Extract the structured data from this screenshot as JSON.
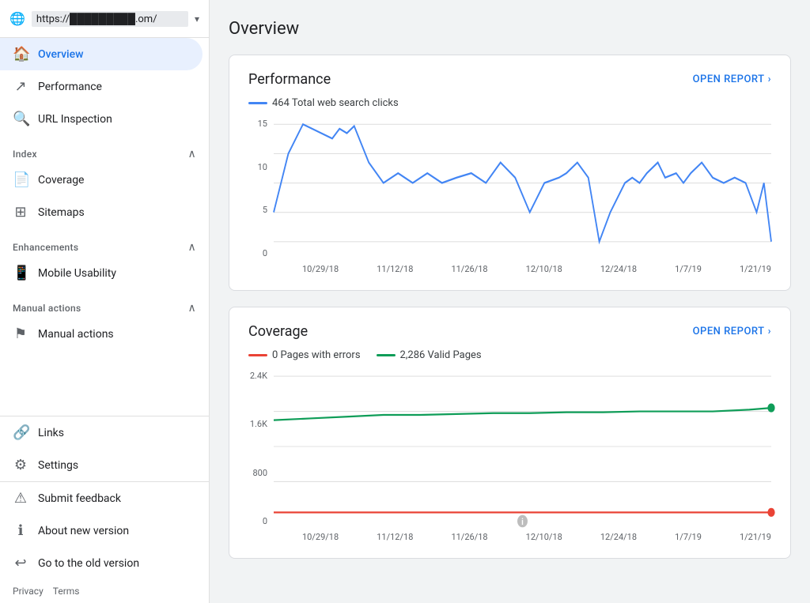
{
  "sidebar": {
    "url": "https://█████████.om/",
    "nav": [
      {
        "id": "overview",
        "label": "Overview",
        "icon": "🏠",
        "active": true
      },
      {
        "id": "performance",
        "label": "Performance",
        "icon": "📈",
        "active": false
      },
      {
        "id": "url-inspection",
        "label": "URL Inspection",
        "icon": "🔍",
        "active": false
      }
    ],
    "sections": [
      {
        "id": "index",
        "label": "Index",
        "collapsed": false,
        "items": [
          {
            "id": "coverage",
            "label": "Coverage",
            "icon": "📄"
          },
          {
            "id": "sitemaps",
            "label": "Sitemaps",
            "icon": "🗺"
          }
        ]
      },
      {
        "id": "enhancements",
        "label": "Enhancements",
        "collapsed": false,
        "items": [
          {
            "id": "mobile-usability",
            "label": "Mobile Usability",
            "icon": "📱"
          }
        ]
      },
      {
        "id": "manual-actions",
        "label": "Manual actions",
        "collapsed": false,
        "items": [
          {
            "id": "manual-actions-item",
            "label": "Manual actions",
            "icon": "🚩"
          }
        ]
      }
    ],
    "bottom_nav": [
      {
        "id": "links",
        "label": "Links",
        "icon": "🔗"
      },
      {
        "id": "settings",
        "label": "Settings",
        "icon": "⚙"
      },
      {
        "id": "submit-feedback",
        "label": "Submit feedback",
        "icon": "⚠"
      },
      {
        "id": "about-new-version",
        "label": "About new version",
        "icon": "ℹ"
      },
      {
        "id": "go-to-old",
        "label": "Go to the old version",
        "icon": "↩"
      }
    ],
    "footer": {
      "privacy": "Privacy",
      "terms": "Terms"
    }
  },
  "main": {
    "title": "Overview",
    "performance_card": {
      "title": "Performance",
      "open_report": "OPEN REPORT",
      "legend": {
        "label": "464 Total web search clicks",
        "color": "#4285f4"
      },
      "y_axis": [
        "15",
        "10",
        "5",
        "0"
      ],
      "x_axis": [
        "10/29/18",
        "11/12/18",
        "11/26/18",
        "12/10/18",
        "12/24/18",
        "1/7/19",
        "1/21/19"
      ]
    },
    "coverage_card": {
      "title": "Coverage",
      "open_report": "OPEN REPORT",
      "legend": [
        {
          "label": "0 Pages with errors",
          "color": "#ea4335",
          "type": "line"
        },
        {
          "label": "2,286 Valid Pages",
          "color": "#0f9d58",
          "type": "line"
        }
      ],
      "y_axis": [
        "2.4K",
        "1.6K",
        "800",
        "0"
      ],
      "x_axis": [
        "10/29/18",
        "11/12/18",
        "11/26/18",
        "12/10/18",
        "12/24/18",
        "1/7/19",
        "1/21/19"
      ]
    }
  },
  "icons": {
    "chevron_right": "›",
    "chevron_down": "∨",
    "collapse_up": "∧"
  }
}
